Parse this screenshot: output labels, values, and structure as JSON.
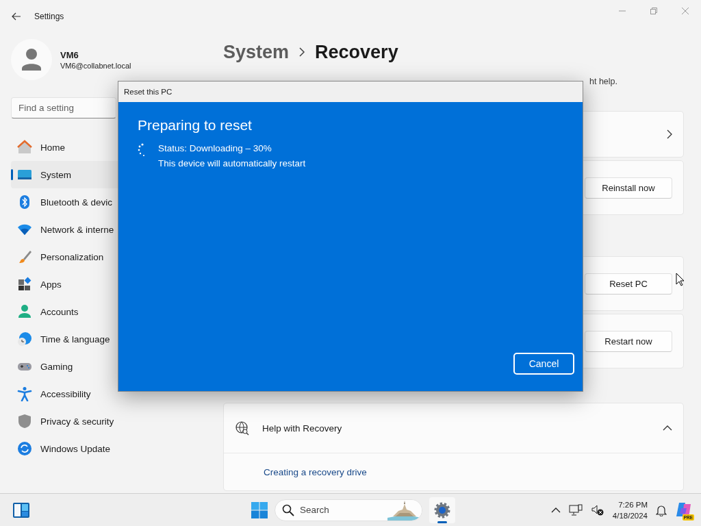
{
  "window": {
    "title": "Settings"
  },
  "user": {
    "name": "VM6",
    "email": "VM6@collabnet.local"
  },
  "search": {
    "placeholder": "Find a setting"
  },
  "nav": [
    {
      "label": "Home",
      "selected": false
    },
    {
      "label": "System",
      "selected": true
    },
    {
      "label": "Bluetooth & devic",
      "selected": false
    },
    {
      "label": "Network & interne",
      "selected": false
    },
    {
      "label": "Personalization",
      "selected": false
    },
    {
      "label": "Apps",
      "selected": false
    },
    {
      "label": "Accounts",
      "selected": false
    },
    {
      "label": "Time & language",
      "selected": false
    },
    {
      "label": "Gaming",
      "selected": false
    },
    {
      "label": "Accessibility",
      "selected": false
    },
    {
      "label": "Privacy & security",
      "selected": false
    },
    {
      "label": "Windows Update",
      "selected": false
    }
  ],
  "page": {
    "breadcrumb": [
      "System",
      "Recovery"
    ],
    "description": "ht help.",
    "sections": [
      {
        "cards": [
          {
            "kind": "link"
          },
          {
            "kind": "button",
            "button": "Reinstall now"
          }
        ]
      },
      {
        "cards": [
          {
            "kind": "button",
            "button": "Reset PC"
          },
          {
            "kind": "button",
            "button": "Restart now"
          }
        ]
      }
    ],
    "help": {
      "title": "Help with Recovery",
      "expanded": true,
      "links": [
        "Creating a recovery drive"
      ]
    }
  },
  "dialog": {
    "title": "Reset this PC",
    "heading": "Preparing to reset",
    "status": "Status: Downloading – 30%",
    "note": "This device will automatically restart",
    "button": "Cancel"
  },
  "taskbar": {
    "search": "Search",
    "time": "7:26 PM",
    "date": "4/18/2024",
    "badge": "PRE"
  }
}
